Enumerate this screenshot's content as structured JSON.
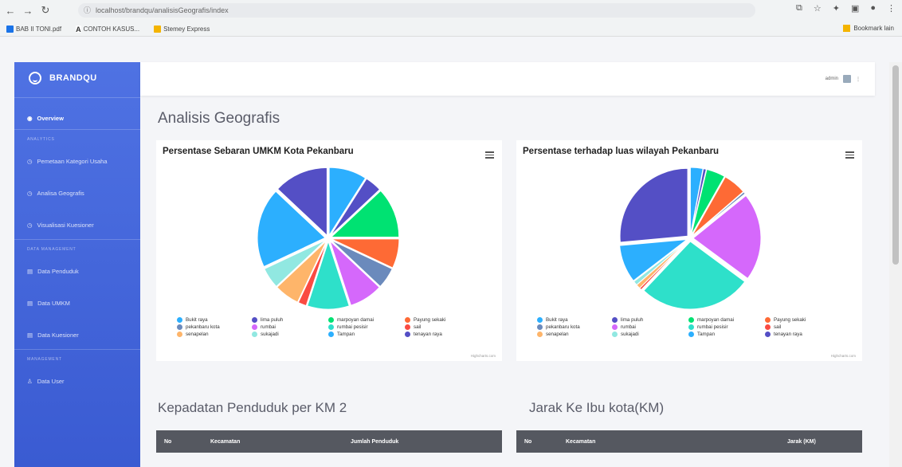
{
  "browser": {
    "url": "localhost/brandqu/analisisGeografis/index",
    "bookmarks": [
      {
        "label": "BAB II TONI.pdf",
        "color": "#1a73e8"
      },
      {
        "label": "CONTOH KASUS...",
        "color": "#e53935"
      },
      {
        "label": "Stemey Express",
        "color": "#f4b400"
      }
    ],
    "bookmarks_right": "Bookmark lain"
  },
  "sidebar": {
    "brand": "BRANDQU",
    "overview": "Overview",
    "heading_analytics": "ANALYTICS",
    "heading_data": "DATA MANAGEMENT",
    "heading_management": "MANAGEMENT",
    "items": [
      {
        "label": "Pemetaan Kategori Usaha"
      },
      {
        "label": "Analisa Geografis"
      },
      {
        "label": "Visualisasi Kuesioner"
      },
      {
        "label": "Data Penduduk"
      },
      {
        "label": "Data UMKM"
      },
      {
        "label": "Data Kuesioner"
      },
      {
        "label": "Data User"
      }
    ]
  },
  "topbar": {
    "user": "admin"
  },
  "page": {
    "title": "Analisis Geografis",
    "section1": "Kepadatan Penduduk per KM 2",
    "section2": "Jarak Ke Ibu kota(KM)",
    "table1_headers": [
      "No",
      "Kecamatan",
      "Jumlah Penduduk"
    ],
    "table2_headers": [
      "No",
      "Kecamatan",
      "Jarak (KM)"
    ]
  },
  "credit": "Highcharts.com",
  "chart_data": [
    {
      "type": "pie",
      "title": "Persentase Sebaran UMKM Kota Pekanbaru",
      "categories": [
        "Bukit raya",
        "lima puluh",
        "marpoyan damai",
        "Payung sekaki",
        "pekanbaru kota",
        "rumbai",
        "rumbai pesisir",
        "sail",
        "senapelan",
        "sukajadi",
        "Tampan",
        "tenayan raya"
      ],
      "values": [
        9,
        4,
        12,
        7,
        5,
        8,
        10,
        2,
        6,
        5,
        19,
        13
      ],
      "colors": [
        "#2caffe",
        "#544fc5",
        "#00e272",
        "#fe6a35",
        "#6b8abc",
        "#d568fb",
        "#2ee0ca",
        "#fa4b42",
        "#feb56a",
        "#91e8e1",
        "#2caffe",
        "#544fc5"
      ]
    },
    {
      "type": "pie",
      "title": "Persentase terhadap luas wilayah Pekanbaru",
      "categories": [
        "Bukit raya",
        "lima puluh",
        "marpoyan damai",
        "Payung sekaki",
        "pekanbaru kota",
        "rumbai",
        "rumbai pesisir",
        "sail",
        "senapelan",
        "sukajadi",
        "Tampan",
        "tenayan raya"
      ],
      "values": [
        3,
        0.7,
        4.5,
        5.5,
        0.5,
        21,
        27,
        0.5,
        1,
        1,
        9,
        26.5
      ],
      "colors": [
        "#2caffe",
        "#544fc5",
        "#00e272",
        "#fe6a35",
        "#6b8abc",
        "#d568fb",
        "#2ee0ca",
        "#fa4b42",
        "#feb56a",
        "#91e8e1",
        "#2caffe",
        "#544fc5"
      ]
    }
  ]
}
